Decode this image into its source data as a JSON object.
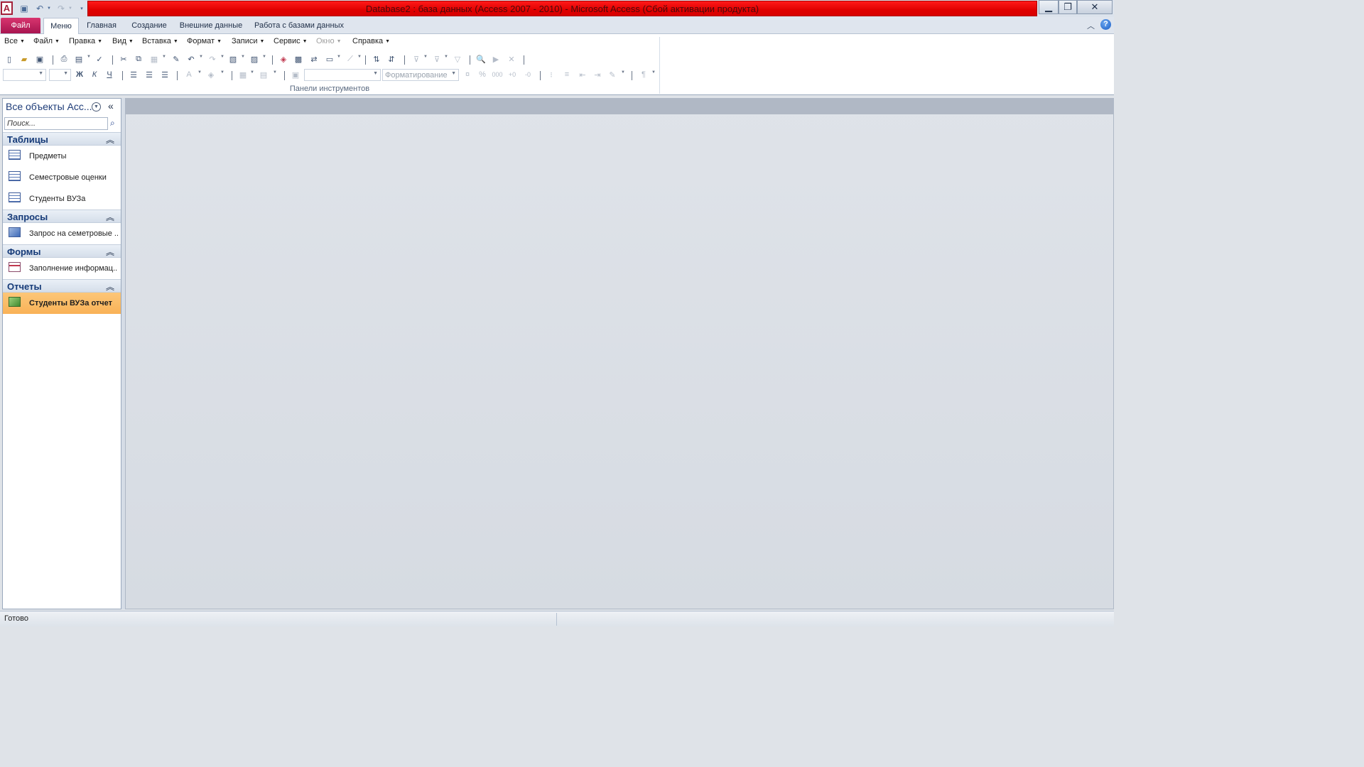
{
  "window": {
    "title": "Database2 : база данных (Access 2007 - 2010)  -  Microsoft Access (Сбой активации продукта)",
    "logo_letter": "A"
  },
  "colors": {
    "title_bar_red": "#e00000",
    "file_tab": "#a81550",
    "selected_item": "#f9b257",
    "group_header_text": "#153a78"
  },
  "ribbon": {
    "file_tab": "Файл",
    "tabs": [
      {
        "label": "Меню",
        "active": true
      },
      {
        "label": "Главная",
        "active": false
      },
      {
        "label": "Создание",
        "active": false
      },
      {
        "label": "Внешние данные",
        "active": false
      },
      {
        "label": "Работа с базами данных",
        "active": false
      }
    ],
    "menu": [
      {
        "label": "Все",
        "enabled": true
      },
      {
        "label": "Файл",
        "enabled": true
      },
      {
        "label": "Правка",
        "enabled": true
      },
      {
        "label": "Вид",
        "enabled": true
      },
      {
        "label": "Вставка",
        "enabled": true
      },
      {
        "label": "Формат",
        "enabled": true
      },
      {
        "label": "Записи",
        "enabled": true
      },
      {
        "label": "Сервис",
        "enabled": true
      },
      {
        "label": "Окно",
        "enabled": false
      },
      {
        "label": "Справка",
        "enabled": true
      }
    ],
    "format_combo_text": "Форматирование",
    "group_label": "Панели инструментов"
  },
  "nav": {
    "title": "Все объекты Acc...",
    "search_placeholder": "Поиск...",
    "groups": [
      {
        "title": "Таблицы",
        "items": [
          {
            "label": "Предметы",
            "icon": "table-icon"
          },
          {
            "label": "Семестровые оценки",
            "icon": "table-icon"
          },
          {
            "label": "Студенты ВУЗа",
            "icon": "table-icon"
          }
        ]
      },
      {
        "title": "Запросы",
        "items": [
          {
            "label": "Запрос на семетровые ...",
            "icon": "query-icon"
          }
        ]
      },
      {
        "title": "Формы",
        "items": [
          {
            "label": "Заполнение информац...",
            "icon": "form-icon"
          }
        ]
      },
      {
        "title": "Отчеты",
        "items": [
          {
            "label": "Студенты ВУЗа отчет",
            "icon": "report-icon",
            "selected": true
          }
        ]
      }
    ]
  },
  "status": {
    "text": "Готово"
  }
}
